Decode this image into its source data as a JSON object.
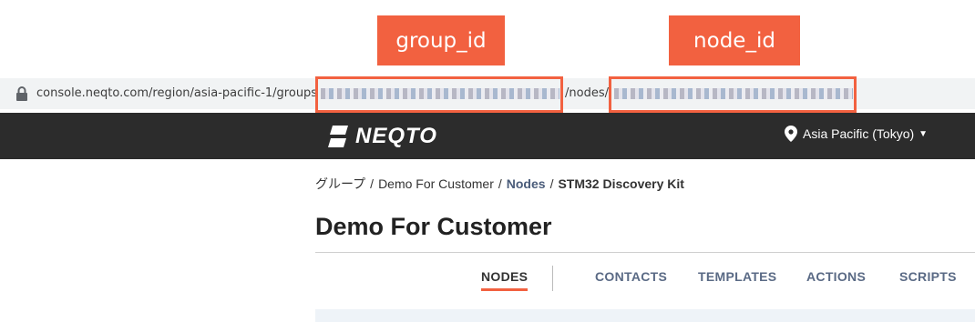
{
  "callouts": {
    "group_id": "group_id",
    "node_id": "node_id"
  },
  "address_bar": {
    "url_prefix": "console.neqto.com/region/asia-pacific-1/groups",
    "url_mid": "/nodes/"
  },
  "navbar": {
    "logo_text": "NEQTO",
    "region_label": "Asia Pacific (Tokyo)"
  },
  "breadcrumb": {
    "root": "グループ",
    "group": "Demo For Customer",
    "section": "Nodes",
    "current": "STM32 Discovery Kit",
    "separator": "/"
  },
  "page_title": "Demo For Customer",
  "tabs": [
    {
      "label": "NODES",
      "active": true
    },
    {
      "label": "CONTACTS"
    },
    {
      "label": "TEMPLATES"
    },
    {
      "label": "ACTIONS"
    },
    {
      "label": "SCRIPTS"
    }
  ],
  "colors": {
    "accent": "#f26140",
    "navbar": "#2c2c2c",
    "tab_text": "#5a6a85"
  }
}
